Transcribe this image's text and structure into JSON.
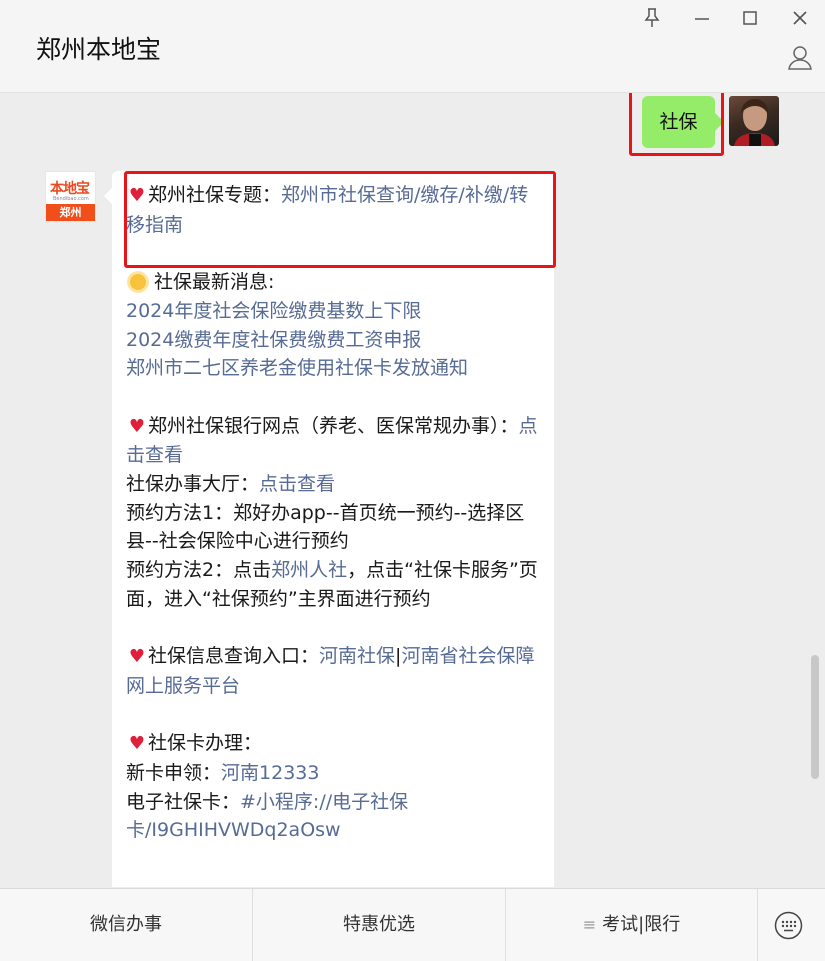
{
  "window": {
    "title": "郑州本地宝"
  },
  "chat": {
    "sent_message": "社保",
    "bot_avatar": {
      "brand": "本地宝",
      "site": "Bendibao.com",
      "city": "郑州"
    },
    "reply": {
      "topic": {
        "prefix": "郑州社保专题：",
        "link": "郑州市社保查询/缴存/补缴/转移指南"
      },
      "news": {
        "heading": "社保最新消息:",
        "links": [
          "2024年度社会保险缴费基数上下限",
          "2024缴费年度社保费缴费工资申报",
          "郑州市二七区养老金使用社保卡发放通知"
        ]
      },
      "bank": {
        "text": "郑州社保银行网点（养老、医保常规办事）：",
        "link": "点击查看"
      },
      "hall": {
        "text": "社保办事大厅：",
        "link": "点击查看"
      },
      "method1": "预约方法1：郑好办app--首页统一预约--选择区县--社会保险中心进行预约",
      "method2": {
        "pre": "预约方法2：点击",
        "link": "郑州人社",
        "post": "，点击“社保卡服务”页面，进入“社保预约”主界面进行预约"
      },
      "query": {
        "text": "社保信息查询入口：",
        "link1": "河南社保",
        "sep": "|",
        "link2": "河南省社会保障网上服务平台"
      },
      "card": {
        "heading": "社保卡办理：",
        "new_label": "新卡申领：",
        "new_link": "河南12333",
        "e_label": "电子社保卡：",
        "e_link": "#小程序://电子社保卡/I9GHIHVWDq2aOsw"
      }
    }
  },
  "menu": {
    "items": [
      "微信办事",
      "特惠优选",
      "考试|限行"
    ],
    "item3_glyph": "≡"
  },
  "icons": {
    "pin": "pin-icon",
    "minimize": "minimize-icon",
    "maximize": "maximize-icon",
    "close": "close-icon",
    "profile": "profile-icon",
    "keyboard": "keyboard-icon",
    "heart": "heart-icon",
    "sun": "sun-icon"
  },
  "colors": {
    "sent_bubble": "#95ec69",
    "link": "#576b95",
    "highlight": "#e8141a",
    "brand": "#f04f1c"
  }
}
